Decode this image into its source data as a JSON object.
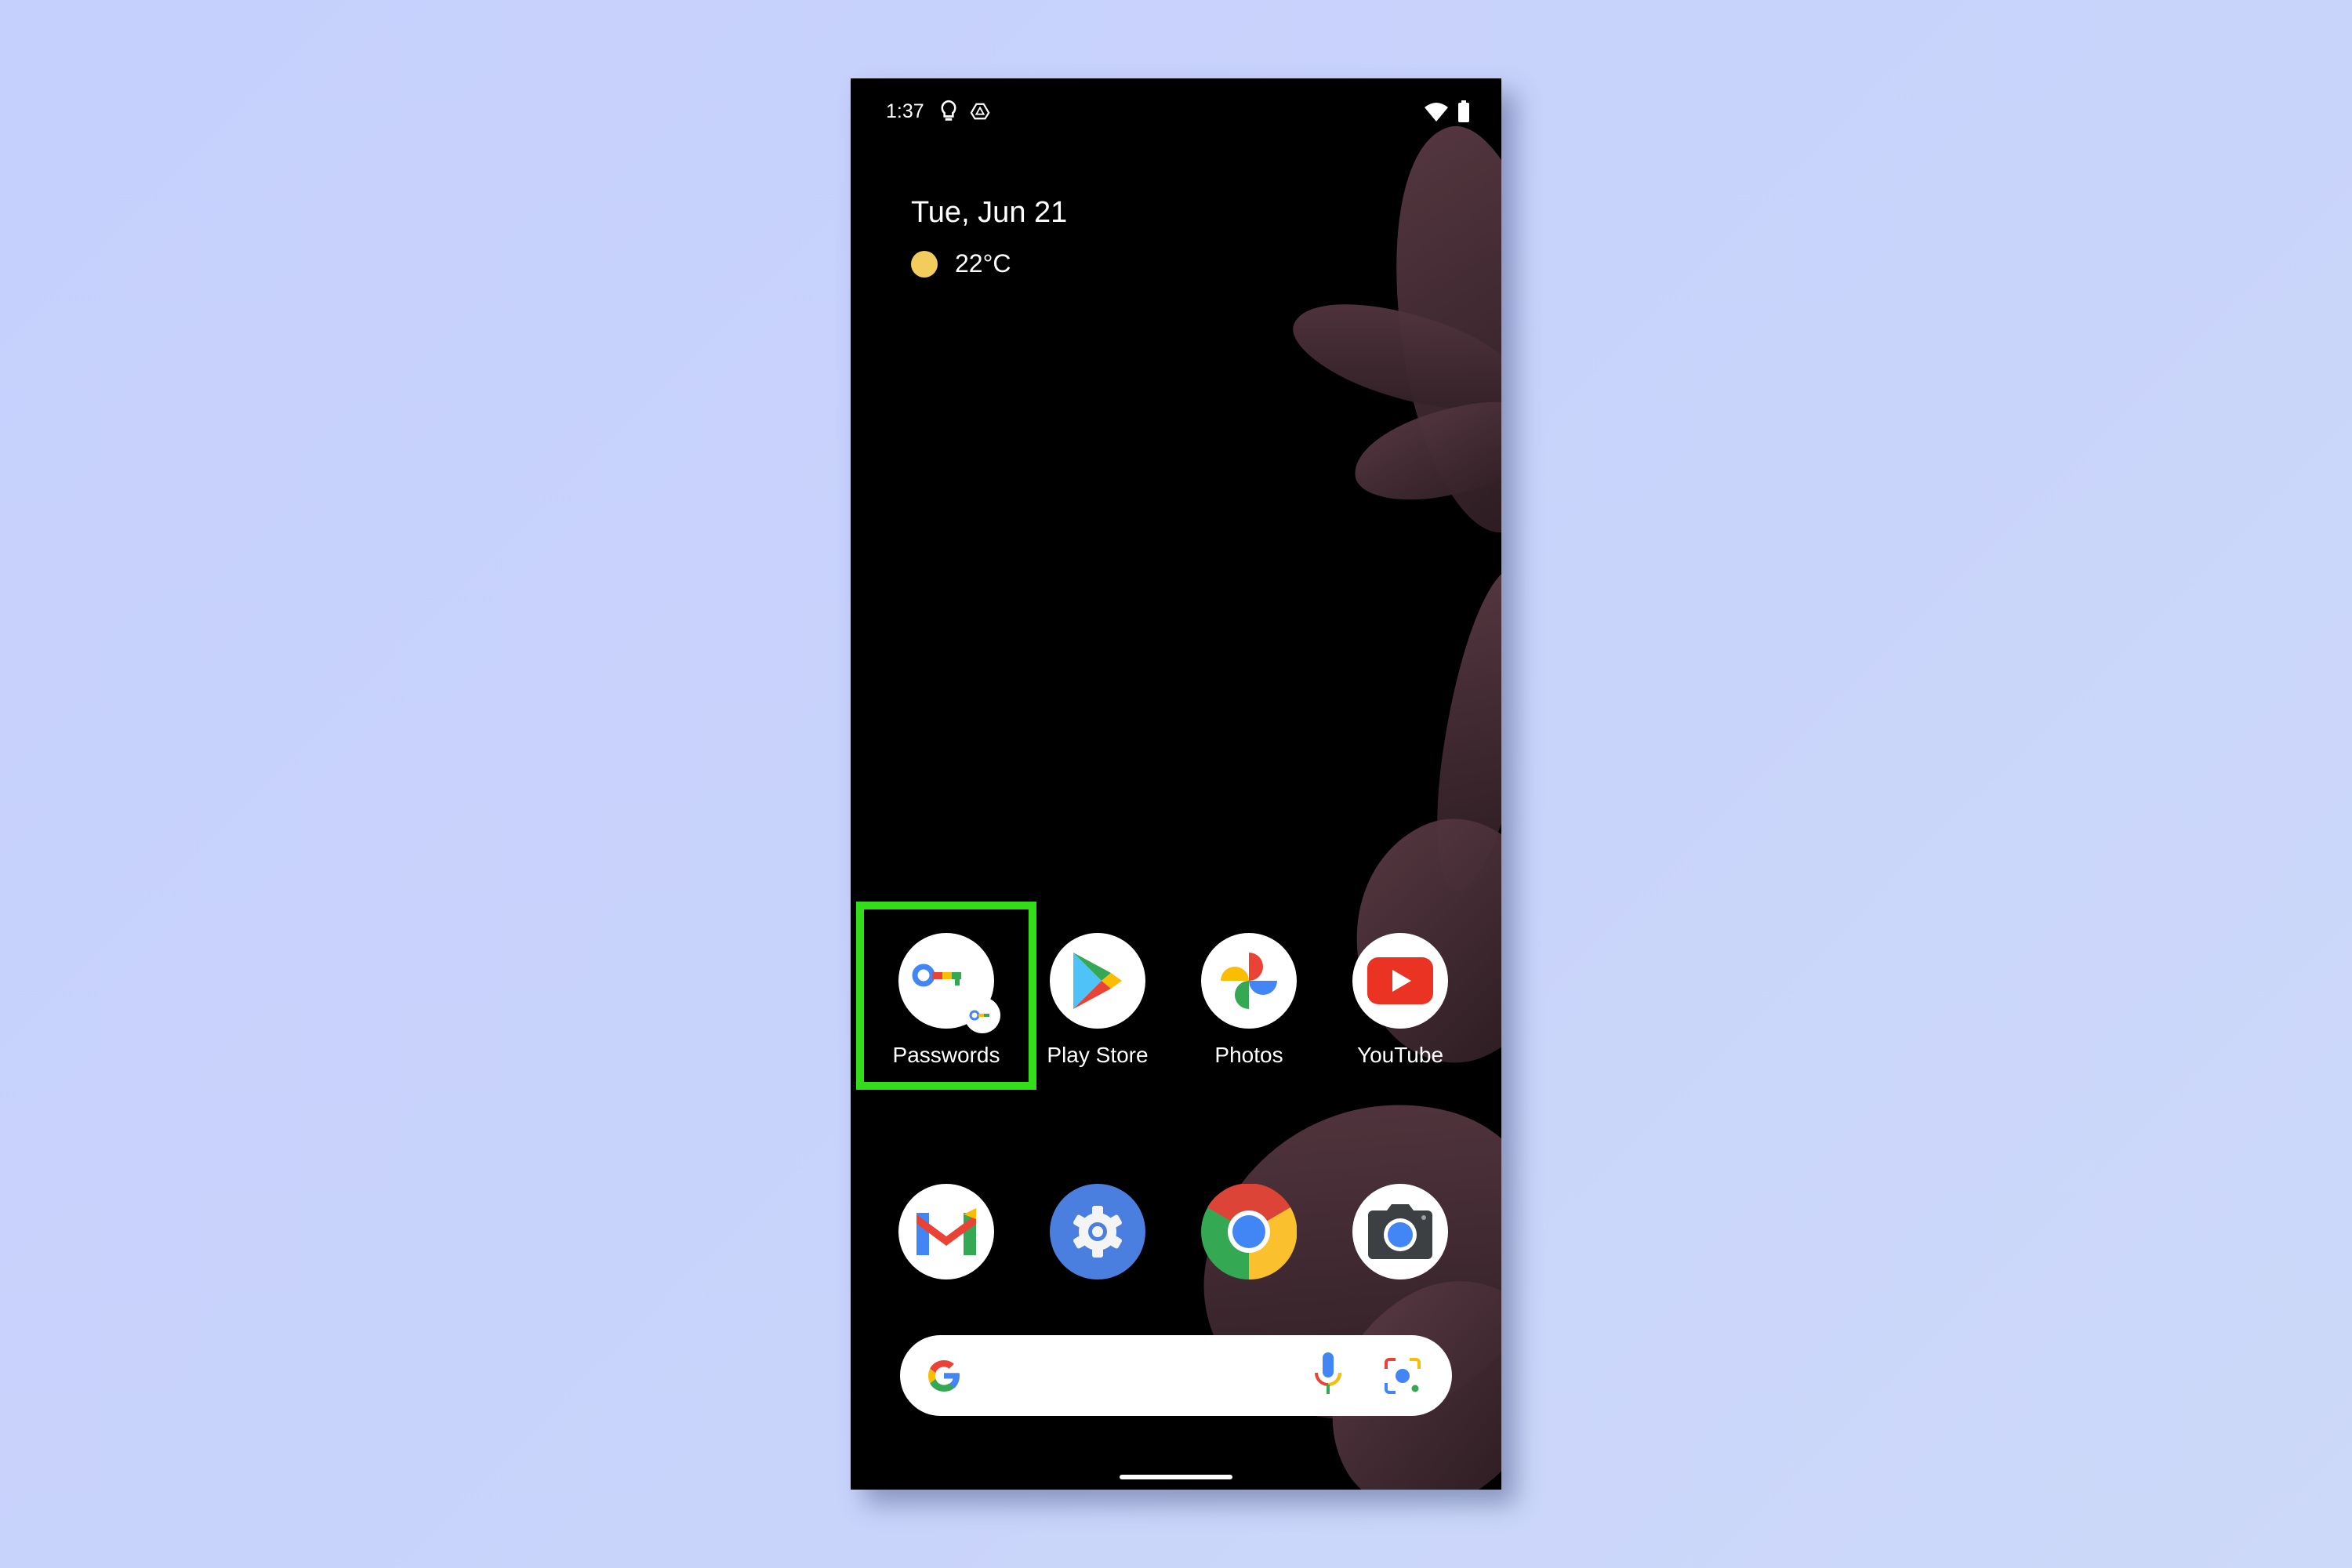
{
  "status_bar": {
    "time": "1:37",
    "left_icons": [
      "lightbulb-icon",
      "drive-icon"
    ],
    "right_icons": [
      "wifi-icon",
      "battery-icon"
    ]
  },
  "widget": {
    "date": "Tue, Jun 21",
    "weather_icon": "sun-icon",
    "temperature": "22°C"
  },
  "apps_row1": [
    {
      "label": "Passwords",
      "icon": "passwords-key-icon",
      "highlighted": true
    },
    {
      "label": "Play Store",
      "icon": "play-store-icon"
    },
    {
      "label": "Photos",
      "icon": "photos-pinwheel-icon"
    },
    {
      "label": "YouTube",
      "icon": "youtube-icon"
    }
  ],
  "dock": [
    {
      "icon": "gmail-icon"
    },
    {
      "icon": "settings-gear-icon"
    },
    {
      "icon": "chrome-icon"
    },
    {
      "icon": "camera-icon"
    }
  ],
  "search_bar": {
    "logo": "google-g-icon",
    "mic": "mic-icon",
    "lens": "lens-icon"
  },
  "colors": {
    "highlight": "#33dd1a",
    "background": "#c8d2fb",
    "google_blue": "#4285f4",
    "google_red": "#ea4335",
    "google_yellow": "#fbbc04",
    "google_green": "#34a853"
  }
}
